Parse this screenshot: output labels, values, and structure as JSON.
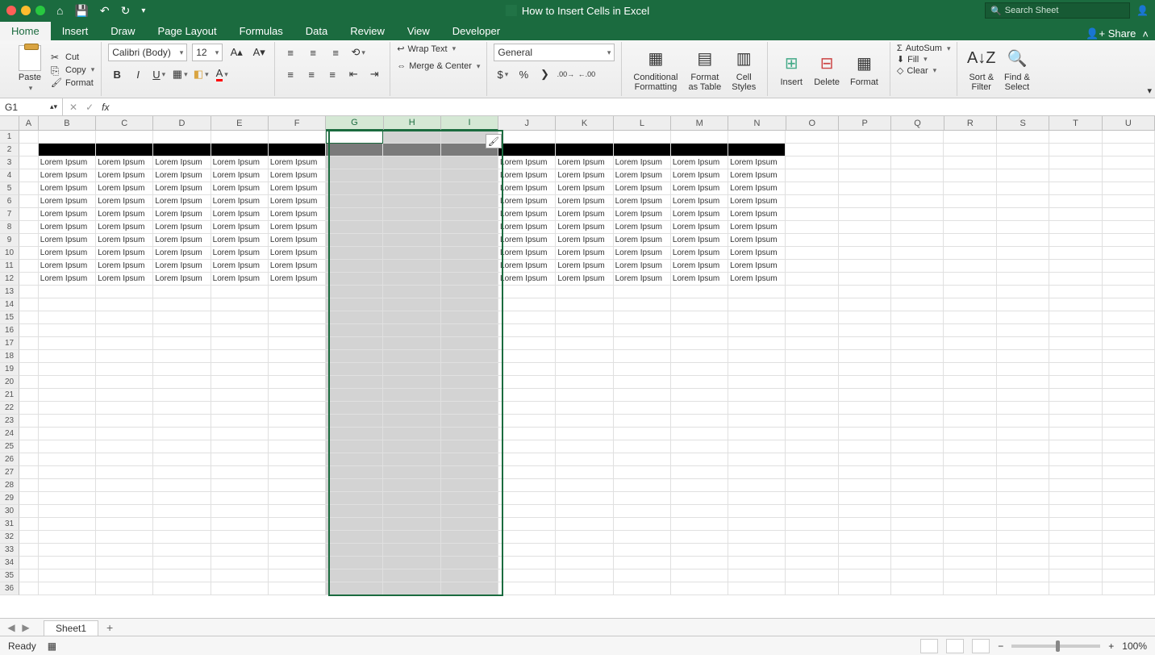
{
  "title": "How to Insert Cells in Excel",
  "search_placeholder": "Search Sheet",
  "share": "Share",
  "tabs": [
    "Home",
    "Insert",
    "Draw",
    "Page Layout",
    "Formulas",
    "Data",
    "Review",
    "View",
    "Developer"
  ],
  "active_tab": "Home",
  "clipboard": {
    "paste": "Paste",
    "cut": "Cut",
    "copy": "Copy",
    "format": "Format"
  },
  "font": {
    "name": "Calibri (Body)",
    "size": "12"
  },
  "alignment": {
    "wrap": "Wrap Text",
    "merge": "Merge & Center"
  },
  "number_format": "General",
  "styles": {
    "cond": "Conditional\nFormatting",
    "table": "Format\nas Table",
    "cell": "Cell\nStyles"
  },
  "cells": {
    "insert": "Insert",
    "delete": "Delete",
    "format": "Format"
  },
  "editing": {
    "autosum": "AutoSum",
    "fill": "Fill",
    "clear": "Clear",
    "sort": "Sort &\nFilter",
    "find": "Find &\nSelect"
  },
  "name_box": "G1",
  "columns": [
    "A",
    "B",
    "C",
    "D",
    "E",
    "F",
    "G",
    "H",
    "I",
    "J",
    "K",
    "L",
    "M",
    "N",
    "O",
    "P",
    "Q",
    "R",
    "S",
    "T",
    "U"
  ],
  "col_widths": {
    "A": 24,
    "default": 72,
    "narrow": 66
  },
  "selected_cols": [
    "G",
    "H",
    "I"
  ],
  "active_cell": "G1",
  "num_rows": 36,
  "black_row": 2,
  "data_rows_start": 3,
  "data_rows_end": 12,
  "data_cols": [
    "B",
    "C",
    "D",
    "E",
    "F",
    "J",
    "K",
    "L",
    "M",
    "N"
  ],
  "cell_text": "Lorem Ipsum",
  "sheet_name": "Sheet1",
  "status": "Ready",
  "zoom": "100%"
}
